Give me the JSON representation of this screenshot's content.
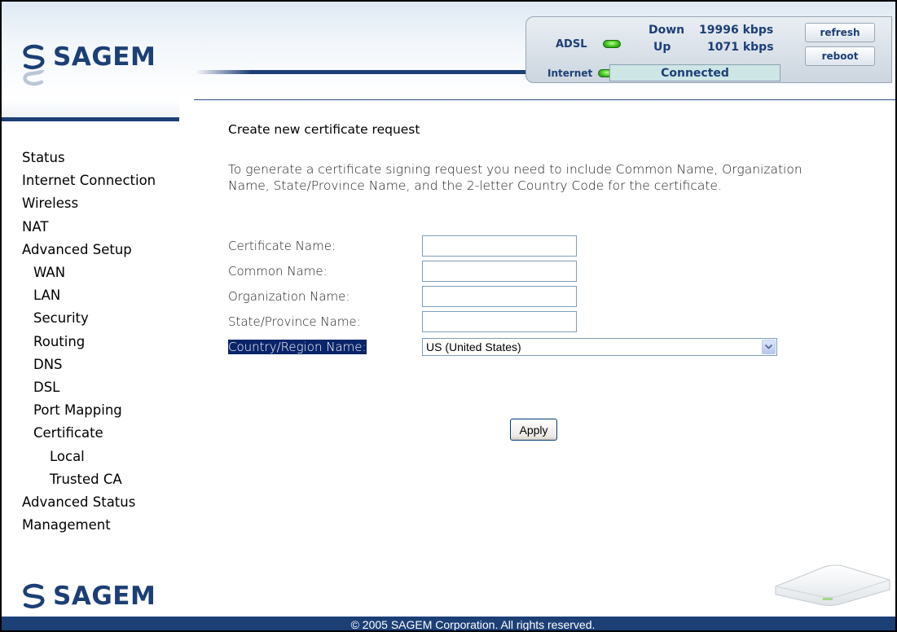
{
  "brand": {
    "name": "SAGEM"
  },
  "status": {
    "adsl_label": "ADSL",
    "internet_label": "Internet",
    "down_label": "Down",
    "down_value": "19996 kbps",
    "up_label": "Up",
    "up_value": "1071 kbps",
    "connection_state": "Connected",
    "refresh_label": "refresh",
    "reboot_label": "reboot",
    "led_color": "#3fc21f"
  },
  "nav": {
    "items": [
      {
        "label": "Status",
        "level": 1
      },
      {
        "label": "Internet Connection",
        "level": 1
      },
      {
        "label": "Wireless",
        "level": 1
      },
      {
        "label": "NAT",
        "level": 1
      },
      {
        "label": "Advanced Setup",
        "level": 1
      },
      {
        "label": "WAN",
        "level": 2
      },
      {
        "label": "LAN",
        "level": 2
      },
      {
        "label": "Security",
        "level": 2
      },
      {
        "label": "Routing",
        "level": 2
      },
      {
        "label": "DNS",
        "level": 2
      },
      {
        "label": "DSL",
        "level": 2
      },
      {
        "label": "Port Mapping",
        "level": 2
      },
      {
        "label": "Certificate",
        "level": 2
      },
      {
        "label": "Local",
        "level": 3
      },
      {
        "label": "Trusted CA",
        "level": 3
      },
      {
        "label": "Advanced Status",
        "level": 1
      },
      {
        "label": "Management",
        "level": 1
      }
    ]
  },
  "main": {
    "title": "Create new certificate request",
    "intro": "To generate a certificate signing request you need to include Common Name, Organization Name, State/Province Name, and the 2-letter Country Code for the certificate.",
    "fields": {
      "certificate_name": {
        "label": "Certificate Name:",
        "value": ""
      },
      "common_name": {
        "label": "Common Name:",
        "value": ""
      },
      "organization_name": {
        "label": "Organization Name:",
        "value": ""
      },
      "state_province_name": {
        "label": "State/Province Name:",
        "value": ""
      },
      "country_region": {
        "label": "Country/Region Name:",
        "selected": "US (United States)"
      }
    },
    "apply_label": "Apply"
  },
  "footer": {
    "copyright": "© 2005 SAGEM Corporation. All rights reserved."
  },
  "colors": {
    "brand_navy": "#1c3f76",
    "selection_highlight": "#0a246a"
  }
}
